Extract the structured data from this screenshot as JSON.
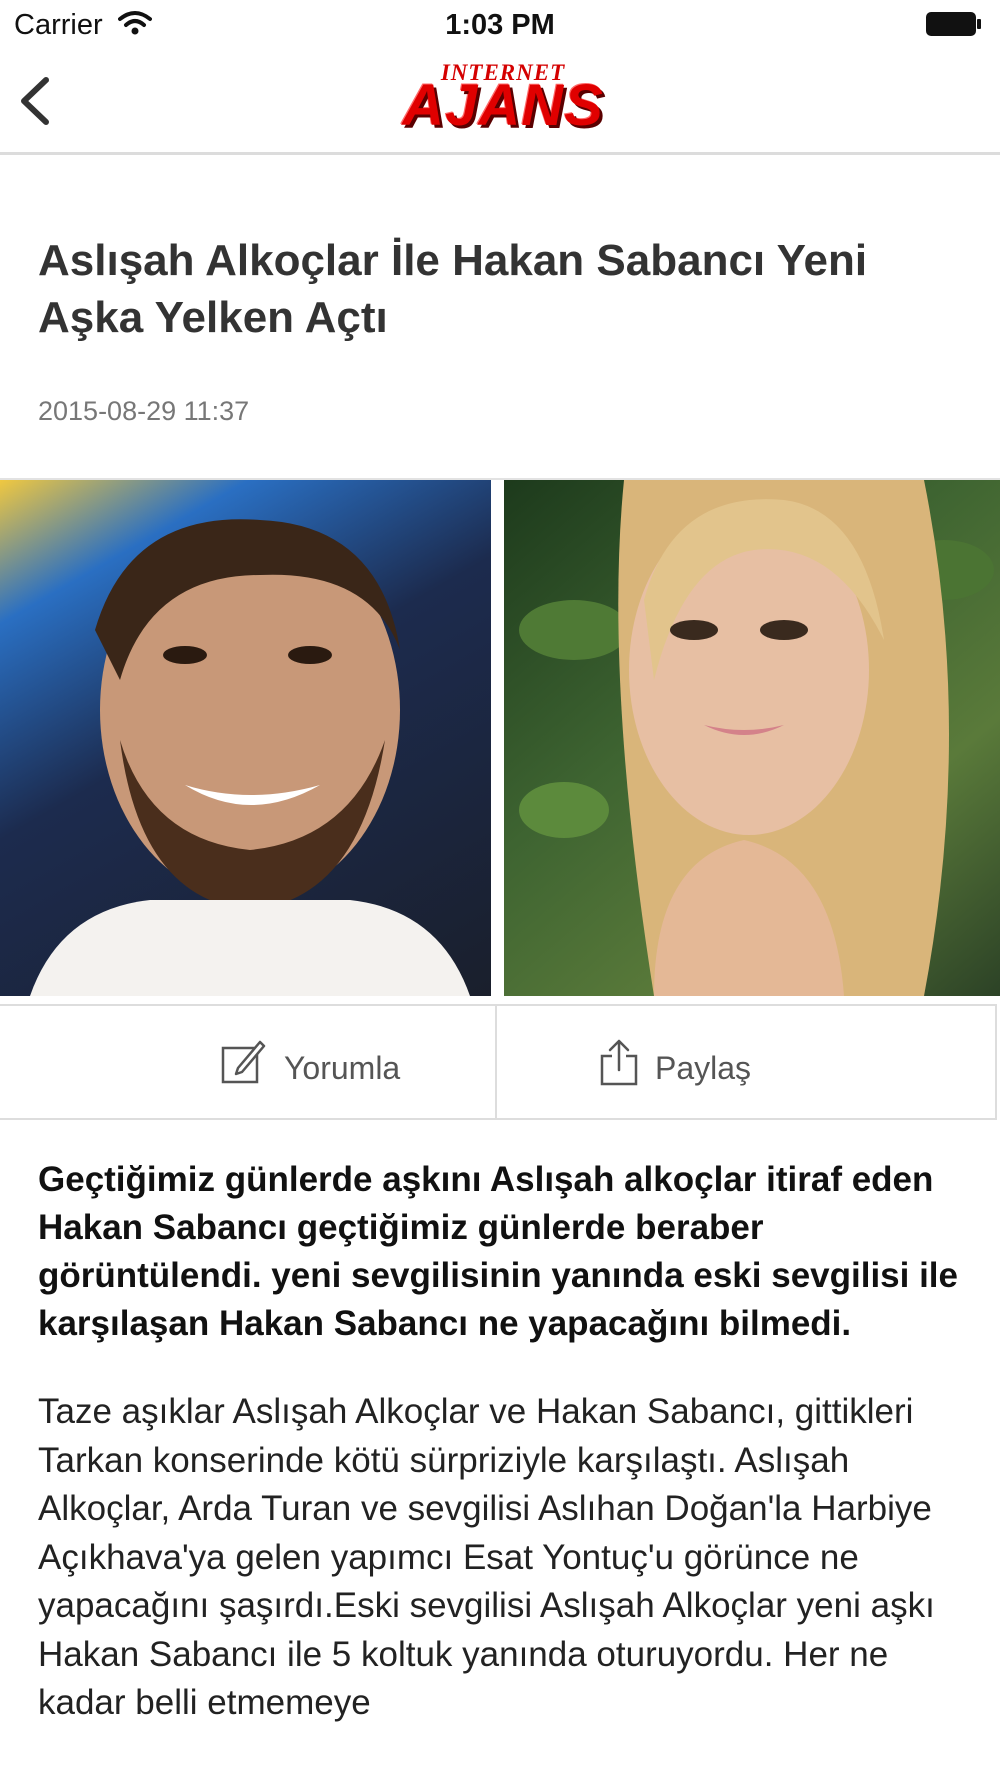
{
  "status_bar": {
    "carrier": "Carrier",
    "time": "1:03 PM",
    "icons": [
      "wifi-icon",
      "battery-icon"
    ]
  },
  "nav": {
    "back_icon": "chevron-left-icon",
    "logo": {
      "top": "INTERNET",
      "main": "AJANS"
    }
  },
  "article": {
    "title": "Aslışah Alkoçlar İle Hakan Sabancı Yeni Aşka Yelken Açtı",
    "date": "2015-08-29 11:37",
    "lead": "Geçtiğimiz günlerde aşkını Aslışah alkoçlar itiraf eden Hakan Sabancı geçtiğimiz günlerde beraber görüntülendi. yeni sevgilisinin yanında eski sevgilisi ile karşılaşan Hakan Sabancı ne yapacağını bilmedi.",
    "paragraph": "Taze aşıklar Aslışah Alkoçlar ve Hakan Sabancı, gittikleri Tarkan konserinde kötü sürpriziyle karşılaştı. Aslışah Alkoçlar, Arda Turan ve sevgilisi Aslıhan Doğan'la Harbiye Açıkhava'ya gelen yapımcı Esat Yontuç'u görünce ne yapacağını şaşırdı.Eski sevgilisi Aslışah Alkoçlar yeni aşkı Hakan Sabancı ile 5 koltuk yanında oturuyordu. Her ne kadar belli etmemeye"
  },
  "actions": {
    "comment": {
      "label": "Yorumla",
      "icon": "compose-icon"
    },
    "share": {
      "label": "Paylaş",
      "icon": "share-icon"
    }
  },
  "colors": {
    "logo_red": "#e00000",
    "divider": "#dddddd",
    "title": "#333333",
    "date": "#777777"
  }
}
